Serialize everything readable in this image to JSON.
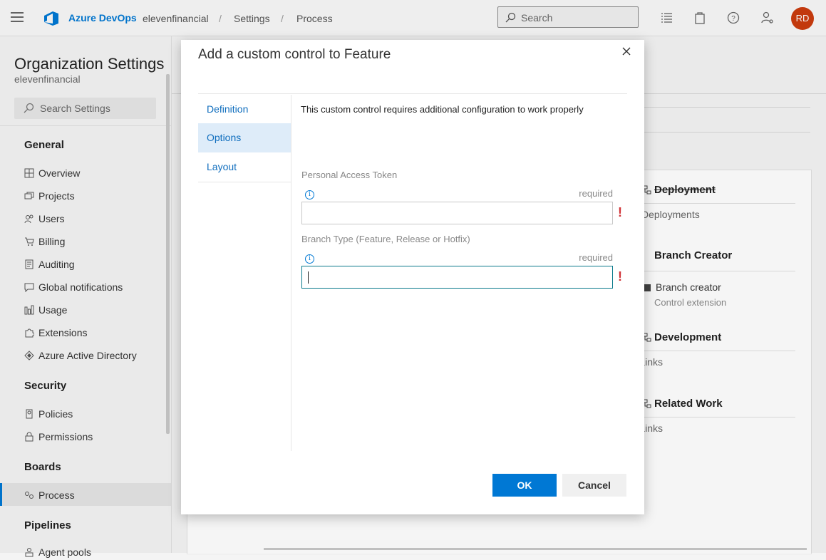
{
  "topbar": {
    "brand": "Azure DevOps",
    "breadcrumb": [
      "elevenfinancial",
      "Settings",
      "Process"
    ],
    "search_placeholder": "Search",
    "avatar_initials": "RD"
  },
  "sidebar": {
    "title": "Organization Settings",
    "subtitle": "elevenfinancial",
    "search_placeholder": "Search Settings",
    "sections": [
      {
        "title": "General",
        "items": [
          "Overview",
          "Projects",
          "Users",
          "Billing",
          "Auditing",
          "Global notifications",
          "Usage",
          "Extensions",
          "Azure Active Directory"
        ]
      },
      {
        "title": "Security",
        "items": [
          "Policies",
          "Permissions"
        ]
      },
      {
        "title": "Boards",
        "items": [
          "Process"
        ]
      },
      {
        "title": "Pipelines",
        "items": [
          "Agent pools"
        ]
      }
    ],
    "selected_item": "Process"
  },
  "background": {
    "groups": [
      {
        "title": "Deployment",
        "sub": "Deployments"
      },
      {
        "title": "Branch Creator",
        "sub": "Branch creator",
        "sub2": "Control extension"
      },
      {
        "title": "Development",
        "sub": "Links"
      },
      {
        "title": "Related Work",
        "sub": "Links"
      }
    ]
  },
  "dialog": {
    "title": "Add a custom control to Feature",
    "tabs": [
      "Definition",
      "Options",
      "Layout"
    ],
    "selected_tab": "Options",
    "message": "This custom control requires additional configuration to work properly",
    "fields": [
      {
        "label": "Personal Access Token",
        "required_text": "required",
        "value": ""
      },
      {
        "label": "Branch Type (Feature, Release or Hotfix)",
        "required_text": "required",
        "value": ""
      }
    ],
    "ok_label": "OK",
    "cancel_label": "Cancel"
  },
  "colors": {
    "accent": "#0078d4",
    "avatar": "#ca3c0e",
    "error": "#d13438",
    "selected_tab": "#deecf9"
  }
}
